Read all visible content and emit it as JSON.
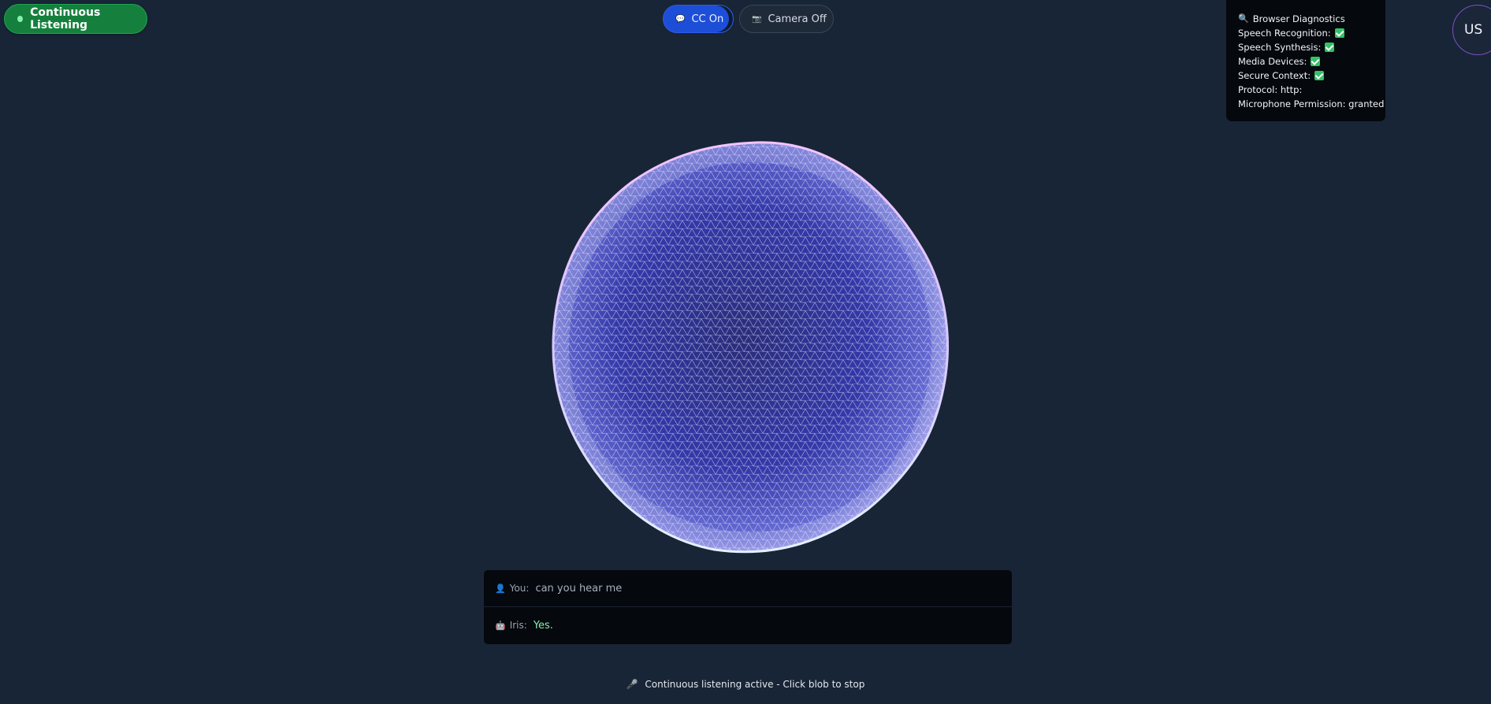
{
  "listening_pill": {
    "label": "Continuous Listening",
    "accent": "#15803d"
  },
  "controls": {
    "cc": {
      "label": "CC On",
      "icon": "speech-bubble-icon",
      "color": "#1d4ed8"
    },
    "camera": {
      "label": "Camera Off",
      "icon": "camera-icon"
    }
  },
  "diagnostics": {
    "title": "Browser Diagnostics",
    "icon": "magnifier-icon",
    "rows": [
      {
        "label": "Speech Recognition:",
        "check": true
      },
      {
        "label": "Speech Synthesis:",
        "check": true
      },
      {
        "label": "Media Devices:",
        "check": true
      },
      {
        "label": "Secure Context:",
        "check": true
      },
      {
        "label": "Protocol: http:",
        "check": false
      },
      {
        "label": "Microphone Permission: granted",
        "check": false
      }
    ]
  },
  "avatar": {
    "initials": "US"
  },
  "transcript": {
    "user": {
      "speaker": "You:",
      "icon": "user-icon",
      "text": "can you hear me"
    },
    "assistant": {
      "speaker": "Iris:",
      "icon": "robot-icon",
      "text": "Yes."
    }
  },
  "status": {
    "icon": "microphone-icon",
    "text": "Continuous listening active - Click blob to stop"
  }
}
